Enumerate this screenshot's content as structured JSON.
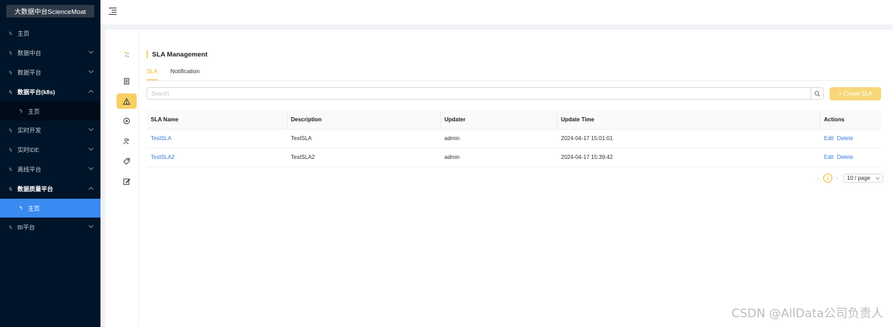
{
  "sidebar": {
    "brand": "大数据中台ScienceMoat",
    "items": [
      {
        "label": "主页"
      },
      {
        "label": "数据中台"
      },
      {
        "label": "数据平台"
      },
      {
        "label": "数据平台(k8s)"
      },
      {
        "label": "主页"
      },
      {
        "label": "实时开发"
      },
      {
        "label": "实时IDE"
      },
      {
        "label": "离线平台"
      },
      {
        "label": "数据质量平台"
      },
      {
        "label": "主页"
      },
      {
        "label": "BI平台"
      }
    ]
  },
  "header": {
    "fold_icon": "menu-fold-icon"
  },
  "rail": {
    "icons": [
      "logo-icon",
      "document-icon",
      "warning-icon",
      "close-circle-icon",
      "users-icon",
      "tag-icon",
      "edit-icon"
    ],
    "selected": "warning-icon"
  },
  "page": {
    "title": "SLA Management",
    "tabs": [
      {
        "label": "SLA"
      },
      {
        "label": "Notification"
      }
    ],
    "search": {
      "placeholder": "Search",
      "value": ""
    },
    "create_button": "+ Create SLA"
  },
  "table": {
    "headers": [
      "SLA Name",
      "Description",
      "Updater",
      "Update Time",
      "Actions"
    ],
    "rows": [
      {
        "name": "TestSLA",
        "description": "TestSLA",
        "updater": "admin",
        "time": "2024-04-17 15:01:01",
        "edit": "Edit",
        "delete": "Delete"
      },
      {
        "name": "TestSLA2",
        "description": "TestSLA2",
        "updater": "admin",
        "time": "2024-04-17 15:39:42",
        "edit": "Edit",
        "delete": "Delete"
      }
    ]
  },
  "pagination": {
    "current": "1",
    "page_size": "10 / page",
    "prev": "‹",
    "next": "›"
  },
  "watermark": "CSDN @AllData公司负责人",
  "colors": {
    "sidebar_bg": "#001529",
    "active_menu": "#3a8af1",
    "accent": "#f7cf63",
    "link": "#3a7bd5"
  }
}
